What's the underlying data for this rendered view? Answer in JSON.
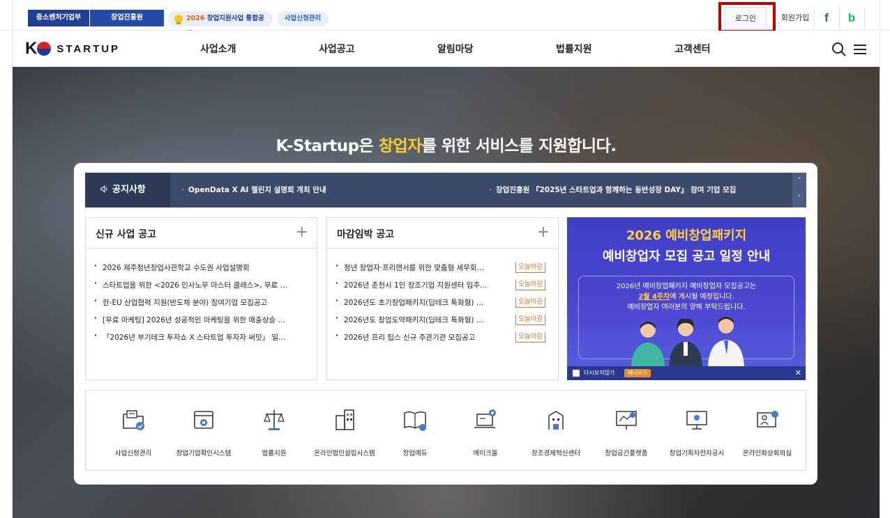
{
  "topbar": {
    "org_tabs": [
      "중소벤처기업부",
      "창업진흥원"
    ],
    "pill_notice_year": "2026",
    "pill_notice_text": " 창업지원사업 통합공고",
    "pill_apply": "사업신청관리",
    "login": "로그인",
    "join": "회원가입",
    "facebook": "f",
    "blog": "b"
  },
  "nav": {
    "logo_k": "K",
    "logo_text": "STARTUP",
    "menu": [
      "사업소개",
      "사업공고",
      "알림마당",
      "법률지원",
      "고객센터"
    ]
  },
  "hero": {
    "title_pre": "K-Startup은 ",
    "title_hl": "창업자",
    "title_post": "를 위한 서비스를 지원합니다."
  },
  "notice": {
    "label": "공지사항",
    "items": [
      "OpenData X AI 챌린지 설명회 개최 안내",
      "창업진흥원 『2025년 스타트업과 함께하는 동반성장 DAY』 참여 기업 모집"
    ],
    "up": "˄",
    "down": "˅"
  },
  "new_business": {
    "title": "신규 사업 공고",
    "more": "+",
    "items": [
      "2026 제주청년창업사관학교 수도권 사업설명회",
      "스타트업을 위한 <2026 인사노무 마스터 클래스>, 무료 …",
      "한-EU 산업협력 지원(반도체 분야) 참여기업 모집공고",
      "[무료 마케팅] 2026년 성공적인 마케팅을 위한 매출상승 …",
      "「2026년 부기테크 투자쇼 X 스타트업 투자자 써밋」 일…"
    ]
  },
  "deadline": {
    "title": "마감임박 공고",
    "more": "+",
    "badge": "오늘마감",
    "items": [
      "청년 창업자·프리랜서를 위한 맞춤형 세무회…",
      "2026년 춘천시 1인 창조기업 지원센터 입주…",
      "2026년도 초기창업패키지(딥테크 특화형) …",
      "2026년도 창업도약패키지(딥테크 특화형) …",
      "2026년 프리 팁스 신규 주관기관 모집공고"
    ]
  },
  "promo": {
    "line1": "2026 예비창업패키지",
    "line2": "예비창업자 모집 공고 일정 안내",
    "text1": "2026년 예비창업패키지 예비창업자 모집공고는",
    "text2_u": "2월 4주차",
    "text2_rest": "에 게시될 예정입니다.",
    "text3": "예비창업자 여러분의 양해 부탁드립니다.",
    "dont_show": "다시보지않기",
    "more": "배너보기",
    "close": "✕"
  },
  "quick_links": [
    {
      "label": "사업신청관리",
      "icon": "folder-check-icon"
    },
    {
      "label": "창업기업확인시스템",
      "icon": "window-check-icon"
    },
    {
      "label": "법률지원",
      "icon": "scale-icon"
    },
    {
      "label": "온라인법인설립시스템",
      "icon": "building-icon"
    },
    {
      "label": "창업에듀",
      "icon": "book-icon"
    },
    {
      "label": "메이크올",
      "icon": "laptop-gear-icon"
    },
    {
      "label": "창조경제혁신센터",
      "icon": "tower-icon"
    },
    {
      "label": "창업공간플랫폼",
      "icon": "board-icon"
    },
    {
      "label": "창업기획자전자공시",
      "icon": "monitor-icon"
    },
    {
      "label": "온라인화상회의실",
      "icon": "video-call-icon"
    }
  ]
}
